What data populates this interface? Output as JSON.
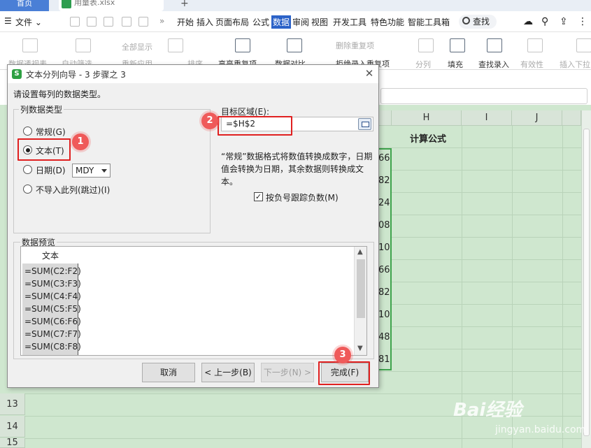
{
  "titlebar": {
    "home_tab": "首页",
    "file_tab": "用量表.xlsx",
    "new_tab": "+"
  },
  "menubar": {
    "file_menu": "文件",
    "tabs": [
      "开始",
      "插入",
      "页面布局",
      "公式",
      "数据",
      "审阅",
      "视图",
      "开发工具",
      "特色功能",
      "智能工具箱"
    ],
    "active_tab": "数据",
    "search": "查找"
  },
  "ribbon": {
    "pivot": "数据透视表",
    "auto_filter": "自动筛选",
    "show_all": "全部显示",
    "reapply": "重新应用",
    "sort": "排序",
    "highlight_dup": "高亮重复项",
    "compare": "数据对比",
    "remove_dup": "删除重复项",
    "reject_dup": "拒绝录入重复项",
    "split": "分列",
    "fill": "填充",
    "lookup_entry": "查找录入",
    "validity": "有效性",
    "insert_dropdown": "插入下拉"
  },
  "sheet": {
    "columns": [
      "H",
      "I",
      "J"
    ],
    "rows": [
      "13",
      "14",
      "15"
    ],
    "calc_header": "计算公式",
    "g_values": [
      "66",
      "82",
      "24",
      "08",
      "10",
      "66",
      "82",
      "10",
      "48",
      "81"
    ]
  },
  "dialog": {
    "title": "文本分列向导 - 3 步骤之 3",
    "close": "✕",
    "prompt": "请设置每列的数据类型。",
    "col_type_group": "列数据类型",
    "options": {
      "general": "常规(G)",
      "text": "文本(T)",
      "date": "日期(D)",
      "skip": "不导入此列(跳过)(I)"
    },
    "date_format": "MDY",
    "target_label": "目标区域(E):",
    "target_value": "=$H$2",
    "description": "“常规”数据格式将数值转换成数字，日期值会转换为日期，其余数据则转换成文本。",
    "checkbox_label": "按负号跟踪负数(M)",
    "checkbox_checked": true,
    "preview_label": "数据预览",
    "preview_header": "文本",
    "preview_rows": [
      "=SUM(C2:F2)",
      "=SUM(C3:F3)",
      "=SUM(C4:F4)",
      "=SUM(C5:F5)",
      "=SUM(C6:F6)",
      "=SUM(C7:F7)",
      "=SUM(C8:F8)"
    ],
    "buttons": {
      "cancel": "取消",
      "prev": "< 上一步(B)",
      "next": "下一步(N) >",
      "finish": "完成(F)"
    }
  },
  "annotations": {
    "badge1": "1",
    "badge2": "2",
    "badge3": "3",
    "color": "#e02020"
  },
  "watermark": {
    "main": "Bai经验",
    "sub": "jingyan.baidu.com"
  }
}
